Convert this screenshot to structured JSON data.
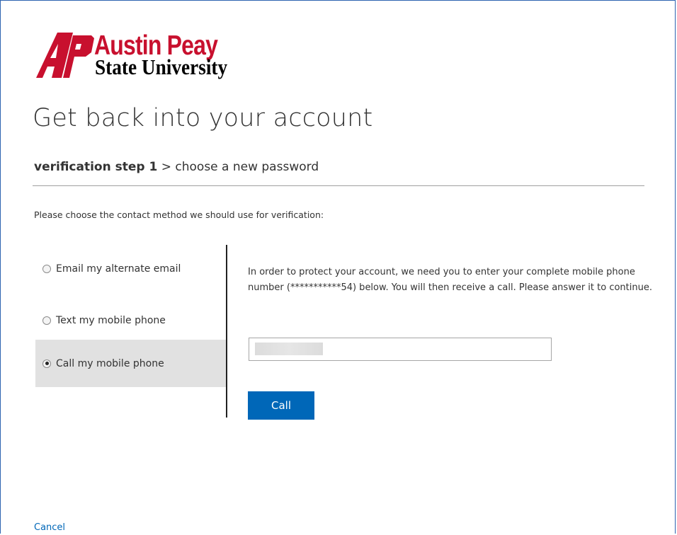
{
  "logo": {
    "line1": "Austin Peay",
    "line2": "State University",
    "mark": "AP",
    "brand_color": "#c8102e"
  },
  "page": {
    "title": "Get back into your account"
  },
  "breadcrumb": {
    "current": "verification step 1",
    "separator": ">",
    "next": "choose a new password"
  },
  "instruction": "Please choose the contact method we should use for verification:",
  "methods": [
    {
      "label": "Email my alternate email",
      "selected": false
    },
    {
      "label": "Text my mobile phone",
      "selected": false
    },
    {
      "label": "Call my mobile phone",
      "selected": true
    }
  ],
  "detail": {
    "text": "In order to protect your account, we need you to enter your complete mobile phone number (***********54) below. You will then receive a call. Please answer it to continue."
  },
  "phone_input": {
    "value": "",
    "placeholder": ""
  },
  "actions": {
    "call_label": "Call",
    "cancel_label": "Cancel"
  },
  "colors": {
    "accent": "#0067b8",
    "selected_row": "#e1e1e1",
    "frame_border": "#2e64b1"
  }
}
